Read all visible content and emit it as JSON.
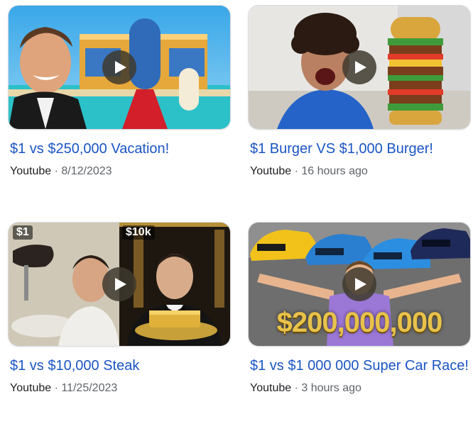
{
  "cards": [
    {
      "title": "$1 vs $250,000 Vacation!",
      "source": "Youtube",
      "date": "8/12/2023"
    },
    {
      "title": "$1 Burger VS $1,000 Burger!",
      "source": "Youtube",
      "date": "16 hours ago"
    },
    {
      "title": "$1 vs $10,000 Steak",
      "source": "Youtube",
      "date": "11/25/2023",
      "badge_left": "$1",
      "badge_right": "$10k"
    },
    {
      "title": "$1 vs $1 000 000 Super Car Race!",
      "source": "Youtube",
      "date": "3 hours ago",
      "overlay_text": "$200,000,000"
    }
  ],
  "separator": "·",
  "colors": {
    "title_link": "#1a55c4",
    "meta_text": "#5f6368",
    "source_text": "#202124",
    "play_button": "#3e392e"
  },
  "icons": {
    "play": "play-triangle-icon"
  }
}
